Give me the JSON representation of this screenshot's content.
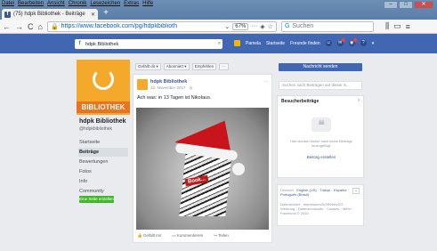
{
  "window": {
    "menu": [
      "Datei",
      "Bearbeiten",
      "Ansicht",
      "Chronik",
      "Lesezeichen",
      "Extras",
      "Hilfe"
    ],
    "tab_title": "(75) hdpk Bibliothek - Beiträge",
    "tab_close": "✕",
    "new_tab": "+",
    "controls": {
      "minimize": "–",
      "maximize": "□",
      "close": "✕"
    }
  },
  "navbar": {
    "back": "←",
    "forward": "→",
    "reload": "C",
    "home": "⌂",
    "url": "https://www.facebook.com/pg/hdpkbiblioth",
    "zoom": "67%",
    "more": "···",
    "search_placeholder": "Suchen",
    "library_icon": "⫼",
    "sidebar_icon": "▭",
    "menu_icon": "≡"
  },
  "fb": {
    "search_value": "hdpk Bibliothek",
    "nav": [
      "Pamela",
      "Startseite",
      "Freunde finden"
    ]
  },
  "page": {
    "cover_word": "BIBLIOTHEK",
    "name": "hdpk Bibliothek",
    "handle": "@hdpkbibliothek",
    "nav": [
      "Startseite",
      "Beiträge",
      "Bewertungen",
      "Fotos",
      "Info",
      "Community"
    ],
    "create_page": "Eine Seite erstellen"
  },
  "actions": [
    "Gefällt dir ▾",
    "Abonniert ▾",
    "Empfehlen",
    "···"
  ],
  "post": {
    "author": "hdpk Bibliothek",
    "date": "22. November 2017 · ◎",
    "menu": "···",
    "text": "Ach was: in 13 Tagen ist Nikolaus.",
    "book_label": "Book...",
    "actions": [
      "Gefällt mir",
      "Kommentieren",
      "Teilen"
    ]
  },
  "right": {
    "message_button": "Nachricht senden",
    "search_placeholder": "Suchen nach Beiträgen auf dieser S...",
    "visitor_title": "Besucherbeiträge",
    "visitor_empty": "Hier wurden bisher noch keine Beiträge hinzugefügt.",
    "visitor_write": "Beitrag erstellen",
    "quote_glyph": "❝",
    "lang_label": "Deutsch ·",
    "langs": "English (US) · Türkçe · Español · Português (Brasil)",
    "plus": "+",
    "footer": "Datenschutz · Impressum/AGB/NetzDG · Werbung · Datenschutzinfo · Cookies · Mehr · Facebook © 2018"
  }
}
